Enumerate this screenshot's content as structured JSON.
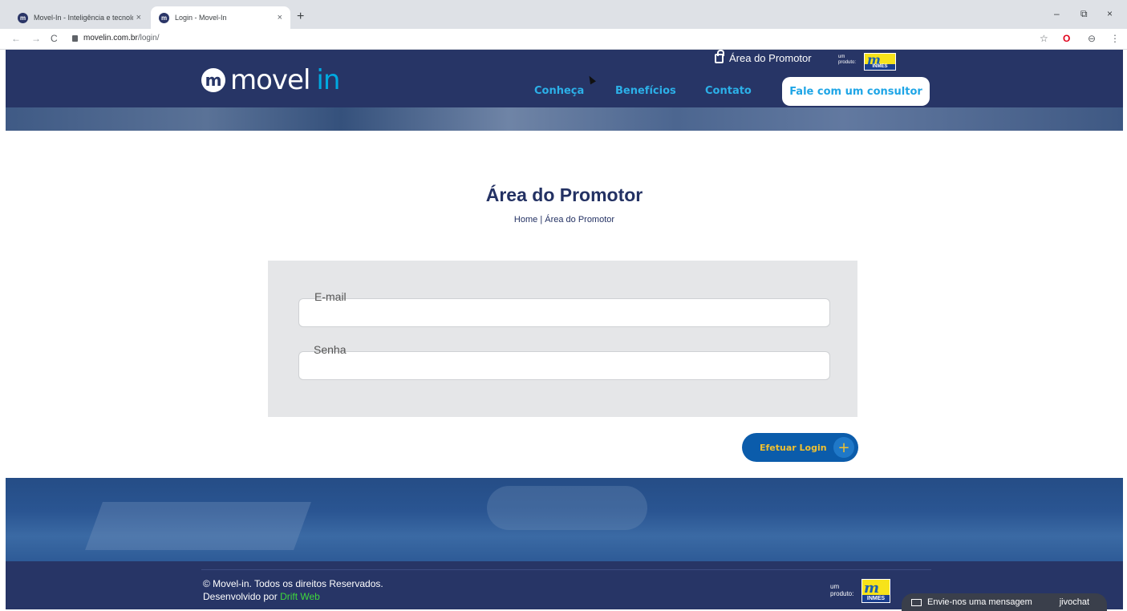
{
  "browser": {
    "tabs": [
      {
        "title": "Movel-In - Inteligência e tecnolo",
        "close": "×",
        "favicon": "m"
      },
      {
        "title": "Login - Movel-In",
        "close": "×",
        "favicon": "m"
      }
    ],
    "new_tab": "+",
    "window": {
      "minimize": "–",
      "restore": "⧉",
      "close": "×"
    },
    "nav": {
      "back": "←",
      "forward": "→",
      "reload": "C"
    },
    "url_host": "movelin.com.br",
    "url_path": "/login/",
    "tools": {
      "star": "☆",
      "opera": "O",
      "profile": "⊖",
      "menu": "⋮"
    }
  },
  "header": {
    "logo_mark": "m",
    "logo_word1": "movel",
    "logo_word2": "in",
    "promotor_link": "Área do Promotor",
    "um_produto": "um produto:",
    "inmes_mark": "m",
    "inmes_label": "INMES",
    "nav": [
      {
        "label": "Conheça"
      },
      {
        "label": "Benefícios"
      },
      {
        "label": "Contato"
      }
    ],
    "cta": "Fale com um consultor"
  },
  "main": {
    "title": "Área do Promotor",
    "breadcrumb": "Home | Área do Promotor",
    "email_label": "E-mail",
    "email_value": "",
    "password_label": "Senha",
    "password_value": "",
    "login_button": "Efetuar Login",
    "login_plus": "+"
  },
  "footer": {
    "copyright": "© Movel-in. Todos os direitos Reservados.",
    "developed_by": "Desenvolvido por ",
    "developer": "Drift Web",
    "um_produto": "um produto:",
    "inmes_mark": "m",
    "inmes_label": "INMES"
  },
  "chat": {
    "label": "Envie-nos uma mensagem",
    "brand": "jivochat"
  },
  "colors": {
    "navy": "#273566",
    "accent_blue": "#2cb0e8",
    "button_blue": "#0b5cab",
    "button_text": "#f0c030",
    "green_link": "#3fd93b"
  }
}
